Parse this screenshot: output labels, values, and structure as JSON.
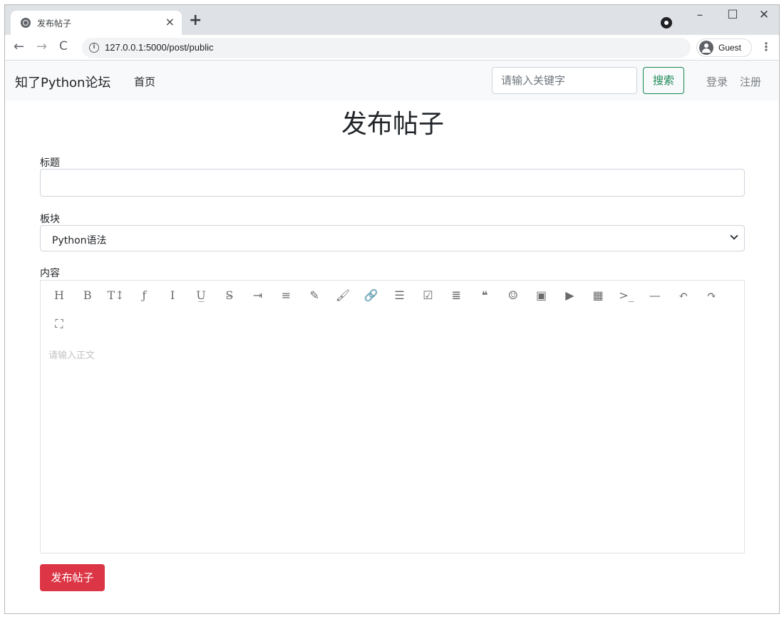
{
  "browser": {
    "tab_title": "发布帖子",
    "tab_close": "×",
    "new_tab": "+",
    "url": "127.0.0.1:5000/post/public",
    "profile": "Guest",
    "window_min": "–",
    "window_max": "☐",
    "window_close": "✕",
    "back": "←",
    "forward": "→",
    "reload": "C",
    "info": "i",
    "menu": "⋮"
  },
  "navbar": {
    "brand": "知了Python论坛",
    "home": "首页",
    "search_placeholder": "请输入关键字",
    "search_button": "搜索",
    "login": "登录",
    "register": "注册"
  },
  "form": {
    "page_title": "发布帖子",
    "title_label": "标题",
    "title_value": "",
    "board_label": "板块",
    "board_selected": "Python语法",
    "content_label": "内容",
    "content_placeholder": "请输入正文",
    "submit": "发布帖子"
  },
  "editor_toolbar": [
    {
      "icon": "heading-icon",
      "glyph": "H"
    },
    {
      "icon": "bold-icon",
      "glyph": "B"
    },
    {
      "icon": "font-size-icon",
      "glyph": "T↕"
    },
    {
      "icon": "font-family-icon",
      "glyph": "ƒ"
    },
    {
      "icon": "italic-icon",
      "glyph": "I"
    },
    {
      "icon": "underline-icon",
      "glyph": "U̲"
    },
    {
      "icon": "strikethrough-icon",
      "glyph": "S̶"
    },
    {
      "icon": "indent-icon",
      "glyph": "⇥"
    },
    {
      "icon": "line-height-icon",
      "glyph": "≡"
    },
    {
      "icon": "font-color-icon",
      "glyph": "✎"
    },
    {
      "icon": "background-color-icon",
      "glyph": "🖌"
    },
    {
      "icon": "link-icon",
      "glyph": "🔗"
    },
    {
      "icon": "list-icon",
      "glyph": "☰"
    },
    {
      "icon": "todo-icon",
      "glyph": "☑"
    },
    {
      "icon": "justify-icon",
      "glyph": "≣"
    },
    {
      "icon": "quote-icon",
      "glyph": "❝"
    },
    {
      "icon": "emoticon-icon",
      "glyph": "☺"
    },
    {
      "icon": "image-icon",
      "glyph": "▣"
    },
    {
      "icon": "video-icon",
      "glyph": "▶"
    },
    {
      "icon": "table-icon",
      "glyph": "▦"
    },
    {
      "icon": "code-icon",
      "glyph": ">_"
    },
    {
      "icon": "divider-icon",
      "glyph": "—"
    },
    {
      "icon": "undo-icon",
      "glyph": "↶"
    },
    {
      "icon": "redo-icon",
      "glyph": "↷"
    },
    {
      "icon": "fullscreen-icon",
      "glyph": "⛶"
    }
  ]
}
